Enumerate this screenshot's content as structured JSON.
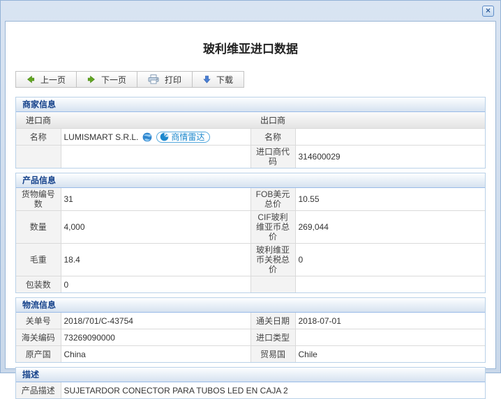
{
  "window": {
    "title": "玻利维亚进口数据",
    "close_glyph": "×"
  },
  "toolbar": {
    "prev_label": "上一页",
    "next_label": "下一页",
    "print_label": "打印",
    "download_label": "下载"
  },
  "merchant": {
    "section_title": "商家信息",
    "importer_header": "进口商",
    "exporter_header": "出口商",
    "name_label": "名称",
    "importer_name": "LUMISMART S.R.L.",
    "radar_badge_label": "商情雷达",
    "exporter_name_label": "名称",
    "exporter_name": "",
    "importer_code_label": "进口商代码",
    "importer_code": "314600029"
  },
  "product": {
    "section_title": "产品信息",
    "rows": [
      {
        "l1": "货物编号数",
        "v1": "31",
        "l2": "FOB美元总价",
        "v2": "10.55"
      },
      {
        "l1": "数量",
        "v1": "4,000",
        "l2": "CIF玻利维亚币总价",
        "v2": "269,044"
      },
      {
        "l1": "毛重",
        "v1": "18.4",
        "l2": "玻利维亚币关税总价",
        "v2": "0"
      },
      {
        "l1": "包装数",
        "v1": "0",
        "l2": "",
        "v2": ""
      }
    ]
  },
  "logistics": {
    "section_title": "物流信息",
    "rows": [
      {
        "l1": "关单号",
        "v1": "2018/701/C-43754",
        "l2": "通关日期",
        "v2": "2018-07-01"
      },
      {
        "l1": "海关编码",
        "v1": "73269090000",
        "l2": "进口类型",
        "v2": ""
      },
      {
        "l1": "原产国",
        "v1": "China",
        "l2": "贸易国",
        "v2": "Chile"
      }
    ]
  },
  "description": {
    "section_title": "描述",
    "label": "产品描述",
    "value": "SUJETARDOR CONECTOR PARA TUBOS LED EN CAJA 2"
  },
  "colors": {
    "section_title_blue": "#15428b",
    "badge_blue": "#1d88cd",
    "arrow_green": "#61a621",
    "arrow_blue": "#4a7fd4",
    "titlebar_blue": "#cfdcec"
  },
  "icons": {
    "close": "close-icon",
    "prev": "arrow-left-icon",
    "next": "arrow-right-icon",
    "print": "printer-icon",
    "download": "arrow-down-icon",
    "globe": "globe-icon",
    "radar": "radar-icon"
  }
}
